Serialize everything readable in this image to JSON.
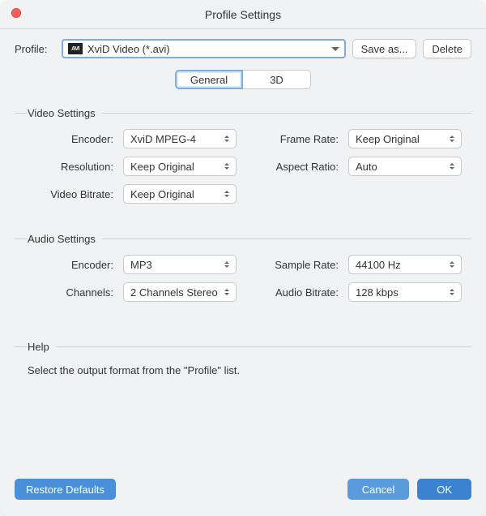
{
  "window": {
    "title": "Profile Settings"
  },
  "profile": {
    "label": "Profile:",
    "selected": "XviD Video (*.avi)",
    "icon_text": "AVI",
    "save_as": "Save as...",
    "delete": "Delete"
  },
  "tabs": {
    "general": "General",
    "three_d": "3D"
  },
  "video": {
    "legend": "Video Settings",
    "encoder_label": "Encoder:",
    "encoder_value": "XviD MPEG-4",
    "frame_rate_label": "Frame Rate:",
    "frame_rate_value": "Keep Original",
    "resolution_label": "Resolution:",
    "resolution_value": "Keep Original",
    "aspect_ratio_label": "Aspect Ratio:",
    "aspect_ratio_value": "Auto",
    "video_bitrate_label": "Video Bitrate:",
    "video_bitrate_value": "Keep Original"
  },
  "audio": {
    "legend": "Audio Settings",
    "encoder_label": "Encoder:",
    "encoder_value": "MP3",
    "sample_rate_label": "Sample Rate:",
    "sample_rate_value": "44100 Hz",
    "channels_label": "Channels:",
    "channels_value": "2 Channels Stereo",
    "audio_bitrate_label": "Audio Bitrate:",
    "audio_bitrate_value": "128 kbps"
  },
  "help": {
    "legend": "Help",
    "text": "Select the output format from the \"Profile\" list."
  },
  "footer": {
    "restore": "Restore Defaults",
    "cancel": "Cancel",
    "ok": "OK"
  }
}
